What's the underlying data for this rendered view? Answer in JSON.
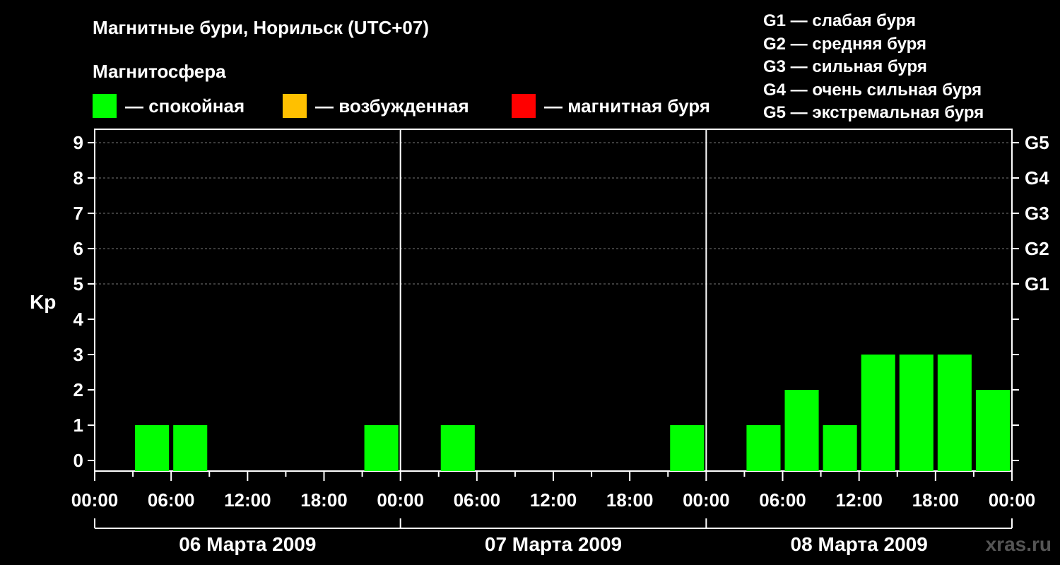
{
  "header": {
    "title": "Магнитные бури, Норильск (UTC+07)",
    "subtitle": "Магнитосфера"
  },
  "legend": [
    {
      "label": "— спокойная",
      "color": "#00ff00"
    },
    {
      "label": "— возбужденная",
      "color": "#ffc000"
    },
    {
      "label": "— магнитная буря",
      "color": "#ff0000"
    }
  ],
  "g_scale": [
    "G1 — слабая буря",
    "G2 — средняя буря",
    "G3 — сильная буря",
    "G4 — очень сильная буря",
    "G5 — экстремальная буря"
  ],
  "watermark": "xras.ru",
  "chart_data": {
    "type": "bar",
    "ylabel": "Kp",
    "ylim": [
      0,
      9
    ],
    "y_ticks": [
      "0",
      "1",
      "2",
      "3",
      "4",
      "5",
      "6",
      "7",
      "8",
      "9"
    ],
    "right_axis_labels": [
      {
        "kp": 5,
        "label": "G1"
      },
      {
        "kp": 6,
        "label": "G2"
      },
      {
        "kp": 7,
        "label": "G3"
      },
      {
        "kp": 8,
        "label": "G4"
      },
      {
        "kp": 9,
        "label": "G5"
      }
    ],
    "x_tick_labels": [
      "00:00",
      "06:00",
      "12:00",
      "18:00",
      "00:00",
      "06:00",
      "12:00",
      "18:00",
      "00:00",
      "06:00",
      "12:00",
      "18:00",
      "00:00"
    ],
    "days": [
      "06 Марта 2009",
      "07 Марта 2009",
      "08 Марта 2009"
    ],
    "interval_hours": 3,
    "grid": "dashed horizontal lines at Kp 5–9",
    "series": [
      {
        "values": [
          0,
          1,
          1,
          0,
          0,
          0,
          0,
          1,
          0,
          1,
          0,
          0,
          0,
          0,
          0,
          1,
          0,
          1,
          2,
          1,
          3,
          3,
          3,
          2
        ],
        "color": "#00ff00"
      }
    ]
  }
}
